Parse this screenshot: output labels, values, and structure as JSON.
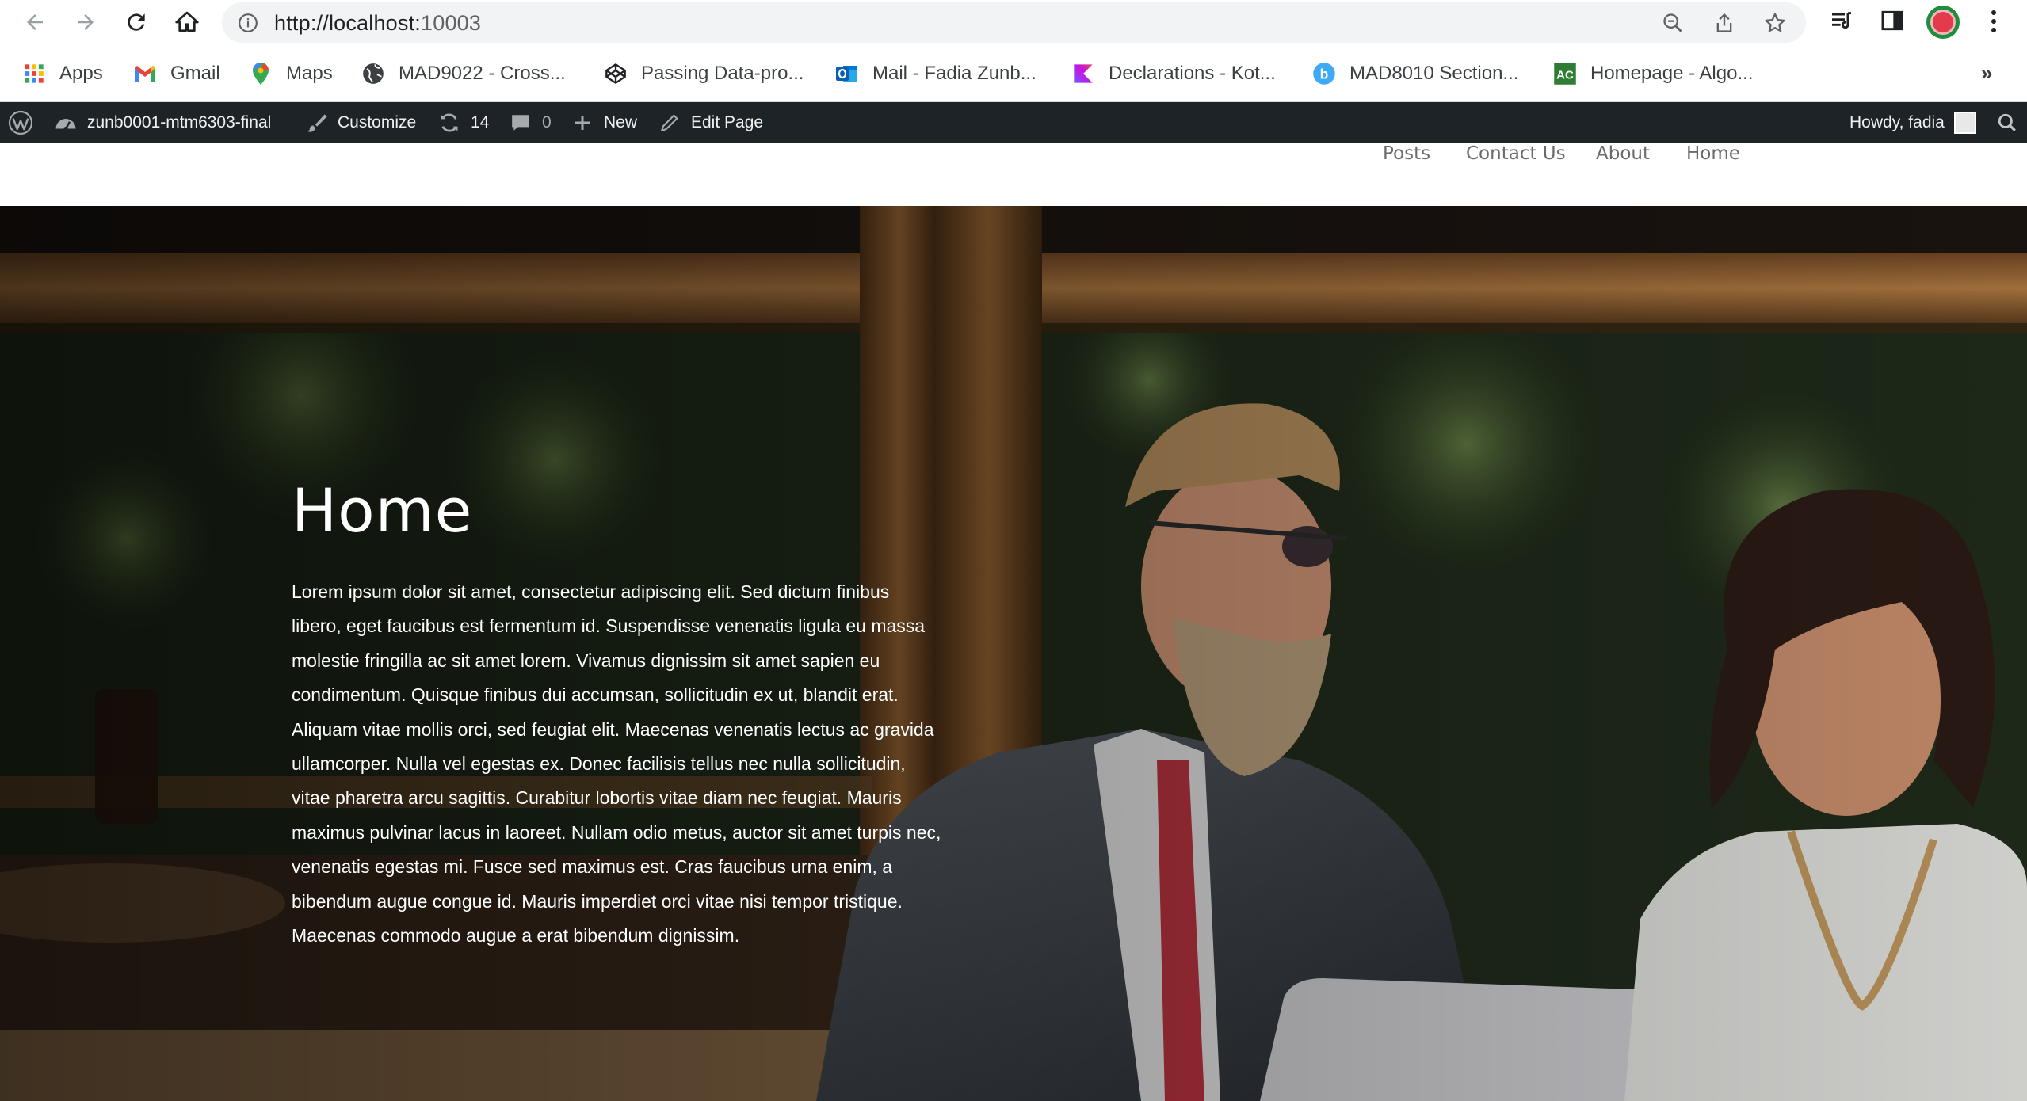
{
  "browser": {
    "url_host": "http://localhost:",
    "url_port": "10003",
    "icons": [
      "back-icon",
      "forward-icon",
      "reload-icon",
      "home-icon",
      "info-icon",
      "zoom-icon",
      "share-icon",
      "star-icon",
      "reading-list-icon",
      "side-panel-icon",
      "kebab-menu-icon"
    ]
  },
  "bookmarks": {
    "items": [
      {
        "label": "Apps",
        "icon": "apps-grid-icon"
      },
      {
        "label": "Gmail",
        "icon": "gmail-icon"
      },
      {
        "label": "Maps",
        "icon": "maps-pin-icon"
      },
      {
        "label": "MAD9022 - Cross...",
        "icon": "globe-icon"
      },
      {
        "label": "Passing Data-pro...",
        "icon": "codepen-icon"
      },
      {
        "label": "Mail - Fadia Zunb...",
        "icon": "outlook-icon"
      },
      {
        "label": "Declarations - Kot...",
        "icon": "kotlin-icon"
      },
      {
        "label": "MAD8010 Section...",
        "icon": "b-icon"
      },
      {
        "label": "Homepage - Algo...",
        "icon": "ac-icon"
      }
    ],
    "more": "»"
  },
  "adminbar": {
    "site_name": "zunb0001-mtm6303-final",
    "customize": "Customize",
    "updates": "14",
    "comments": "0",
    "new": "New",
    "edit_page": "Edit Page",
    "howdy": "Howdy, fadia"
  },
  "site": {
    "menu": [
      "Posts",
      "Contact Us",
      "About",
      "Home"
    ]
  },
  "hero": {
    "title": "Home",
    "body_lines": [
      "Lorem ipsum dolor sit amet, consectetur adipiscing elit. Sed dictum finibus",
      "libero, eget faucibus est fermentum id. Suspendisse venenatis ligula eu massa",
      "molestie fringilla ac sit amet lorem. Vivamus dignissim sit amet sapien eu",
      "condimentum. Quisque finibus dui accumsan, sollicitudin ex ut, blandit erat.",
      "Aliquam vitae mollis orci, sed feugiat elit. Maecenas venenatis lectus ac gravida",
      "ullamcorper. Nulla vel egestas ex. Donec facilisis tellus nec nulla sollicitudin,",
      "vitae pharetra arcu sagittis. Curabitur lobortis vitae diam nec feugiat. Mauris",
      "maximus pulvinar lacus in laoreet. Nullam odio metus, auctor sit amet turpis nec,",
      "venenatis egestas mi. Fusce sed maximus est. Cras faucibus urna enim, a",
      "bibendum augue congue id. Mauris imperdiet orci vitae nisi tempor tristique.",
      "Maecenas commodo augue a erat bibendum dignissim."
    ]
  }
}
